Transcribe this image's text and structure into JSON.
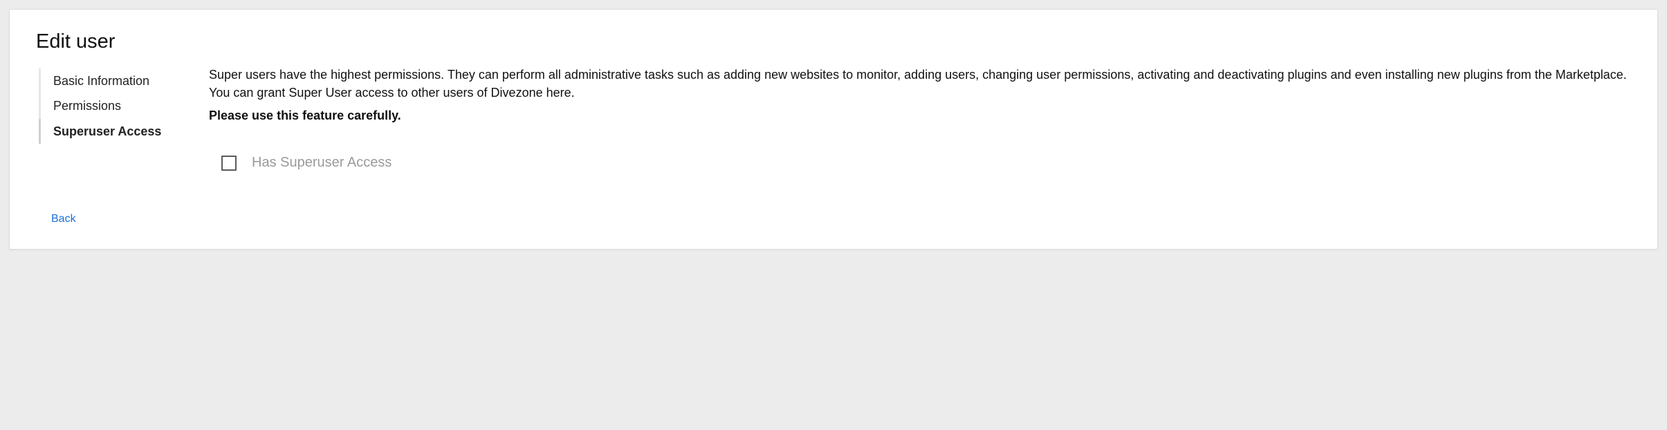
{
  "page": {
    "title": "Edit user"
  },
  "sidebar": {
    "tabs": [
      {
        "label": "Basic Information"
      },
      {
        "label": "Permissions"
      },
      {
        "label": "Superuser Access"
      }
    ],
    "back": "Back"
  },
  "content": {
    "description": "Super users have the highest permissions. They can perform all administrative tasks such as adding new websites to monitor, adding users, changing user permissions, activating and deactivating plugins and even installing new plugins from the Marketplace. You can grant Super User access to other users of Divezone here.",
    "warning": "Please use this feature carefully.",
    "checkbox_label": "Has Superuser Access"
  }
}
